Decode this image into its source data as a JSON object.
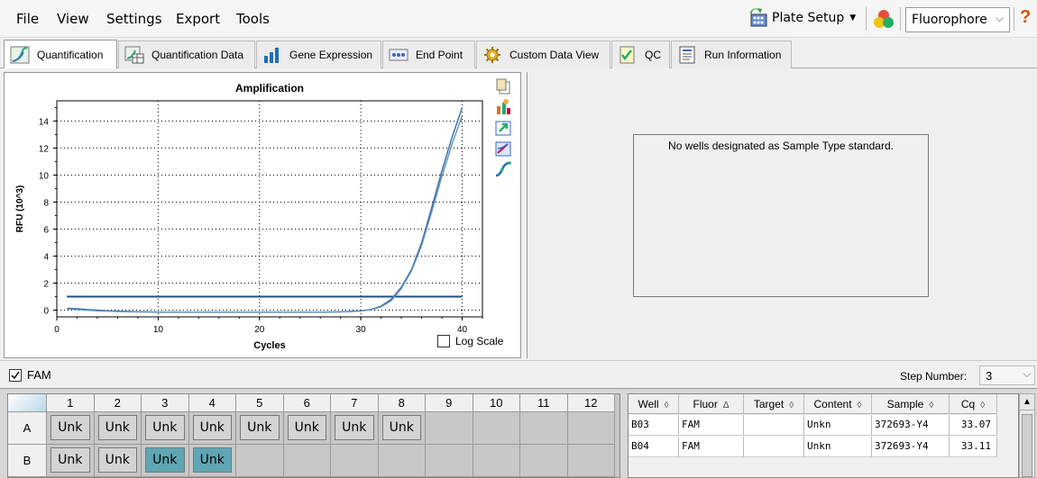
{
  "menu": [
    "File",
    "View",
    "Settings",
    "Export",
    "Tools"
  ],
  "toolbar": {
    "plate_setup": "Plate Setup",
    "fluorophore": "Fluorophore",
    "help": "?"
  },
  "tabs": [
    "Quantification",
    "Quantification Data",
    "Gene Expression",
    "End Point",
    "Custom Data View",
    "QC",
    "Run Information"
  ],
  "chart_data": {
    "type": "line",
    "title": "Amplification",
    "xlabel": "Cycles",
    "ylabel": "RFU (10^3)",
    "xlim": [
      0,
      42
    ],
    "ylim": [
      -0.5,
      15.5
    ],
    "xticks": [
      0,
      10,
      20,
      30,
      40
    ],
    "yticks": [
      0,
      2,
      4,
      6,
      8,
      10,
      12,
      14
    ],
    "grid": true,
    "threshold": 1.0,
    "series": [
      {
        "color": "#3a6ea5",
        "x": [
          1,
          2,
          3,
          4,
          5,
          6,
          7,
          8,
          9,
          10,
          11,
          12,
          13,
          14,
          15,
          16,
          17,
          18,
          19,
          20,
          21,
          22,
          23,
          24,
          25,
          26,
          27,
          28,
          29,
          30,
          31,
          32,
          33,
          34,
          35,
          36,
          37,
          38,
          39,
          40
        ],
        "values": [
          0.15,
          0.1,
          0.05,
          0.0,
          -0.05,
          -0.08,
          -0.1,
          -0.12,
          -0.13,
          -0.14,
          -0.15,
          -0.15,
          -0.15,
          -0.15,
          -0.15,
          -0.15,
          -0.15,
          -0.15,
          -0.15,
          -0.15,
          -0.15,
          -0.15,
          -0.15,
          -0.15,
          -0.15,
          -0.15,
          -0.14,
          -0.13,
          -0.1,
          -0.05,
          0.05,
          0.3,
          0.8,
          1.7,
          3.0,
          5.0,
          7.6,
          10.3,
          12.8,
          15.0
        ]
      },
      {
        "color": "#5b8fc2",
        "x": [
          1,
          2,
          3,
          4,
          5,
          6,
          7,
          8,
          9,
          10,
          11,
          12,
          13,
          14,
          15,
          16,
          17,
          18,
          19,
          20,
          21,
          22,
          23,
          24,
          25,
          26,
          27,
          28,
          29,
          30,
          31,
          32,
          33,
          34,
          35,
          36,
          37,
          38,
          39,
          40
        ],
        "values": [
          0.1,
          0.05,
          0.0,
          -0.05,
          -0.08,
          -0.1,
          -0.12,
          -0.13,
          -0.14,
          -0.15,
          -0.15,
          -0.15,
          -0.15,
          -0.15,
          -0.15,
          -0.15,
          -0.15,
          -0.15,
          -0.15,
          -0.15,
          -0.15,
          -0.15,
          -0.15,
          -0.15,
          -0.15,
          -0.15,
          -0.14,
          -0.13,
          -0.1,
          -0.06,
          0.03,
          0.25,
          0.7,
          1.6,
          2.9,
          4.8,
          7.3,
          9.9,
          12.3,
          14.4
        ]
      }
    ]
  },
  "log_scale_label": "Log Scale",
  "no_wells_message": "No wells designated as Sample Type standard.",
  "fam_label": "FAM",
  "step_number_label": "Step Number:",
  "step_number_value": "3",
  "plate": {
    "columns": [
      "1",
      "2",
      "3",
      "4",
      "5",
      "6",
      "7",
      "8",
      "9",
      "10",
      "11",
      "12"
    ],
    "rows": [
      {
        "label": "A",
        "wells": [
          "Unk",
          "Unk",
          "Unk",
          "Unk",
          "Unk",
          "Unk",
          "Unk",
          "Unk",
          "",
          "",
          "",
          ""
        ],
        "selected": []
      },
      {
        "label": "B",
        "wells": [
          "Unk",
          "Unk",
          "Unk",
          "Unk",
          "",
          "",
          "",
          "",
          "",
          "",
          "",
          ""
        ],
        "selected": [
          2,
          3
        ]
      }
    ]
  },
  "table": {
    "headers": [
      "Well",
      "Fluor",
      "Target",
      "Content",
      "Sample",
      "Cq"
    ],
    "rows": [
      [
        "B03",
        "FAM",
        "",
        "Unkn",
        "372693-Y4",
        "33.07"
      ],
      [
        "B04",
        "FAM",
        "",
        "Unkn",
        "372693-Y4",
        "33.11"
      ]
    ]
  }
}
